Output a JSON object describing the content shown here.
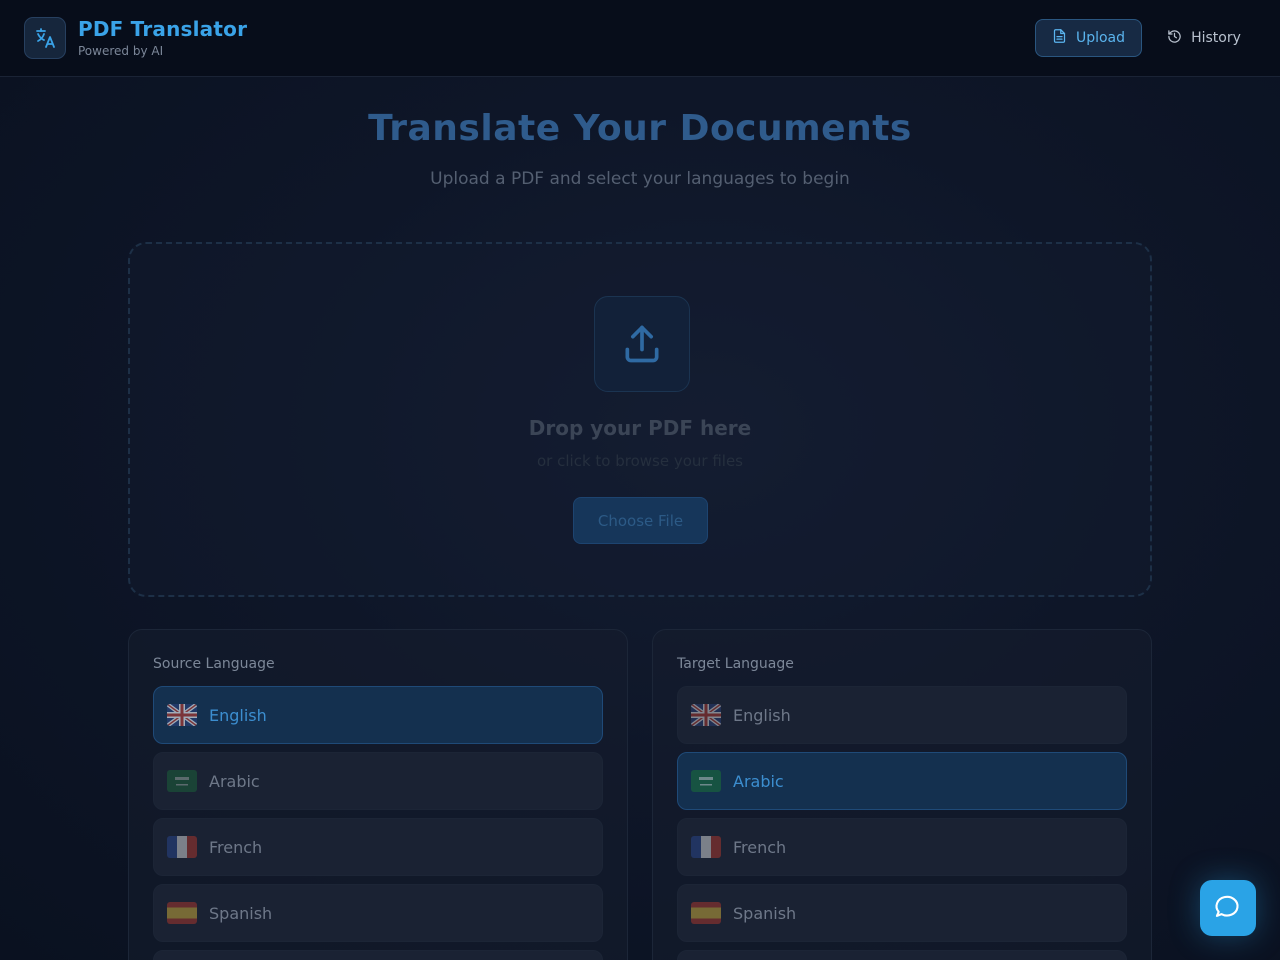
{
  "header": {
    "brand_title": "PDF Translator",
    "brand_subtitle": "Powered by AI",
    "logo_icon": "translate-icon",
    "nav": {
      "upload_label": "Upload",
      "upload_icon": "document-icon",
      "history_label": "History",
      "history_icon": "history-icon",
      "active": "Upload"
    }
  },
  "hero": {
    "title": "Translate Your Documents",
    "subtitle": "Upload a PDF and select your languages to begin"
  },
  "dropzone": {
    "icon": "upload-icon",
    "title": "Drop your PDF here",
    "subtitle": "or click to browse your files",
    "button_label": "Choose File"
  },
  "source": {
    "label": "Source Language",
    "selected": "English",
    "options": [
      {
        "name": "English",
        "flag": "uk-flag-icon"
      },
      {
        "name": "Arabic",
        "flag": "saudi-flag-icon"
      },
      {
        "name": "French",
        "flag": "france-flag-icon"
      },
      {
        "name": "Spanish",
        "flag": "spain-flag-icon"
      }
    ]
  },
  "target": {
    "label": "Target Language",
    "selected": "Arabic",
    "options": [
      {
        "name": "English",
        "flag": "uk-flag-icon"
      },
      {
        "name": "Arabic",
        "flag": "saudi-flag-icon"
      },
      {
        "name": "French",
        "flag": "france-flag-icon"
      },
      {
        "name": "Spanish",
        "flag": "spain-flag-icon"
      }
    ]
  },
  "fab": {
    "icon": "chat-icon"
  },
  "colors": {
    "accent": "#2aa3e6",
    "brand": "#3aa3e8",
    "background": "#0e1628"
  }
}
